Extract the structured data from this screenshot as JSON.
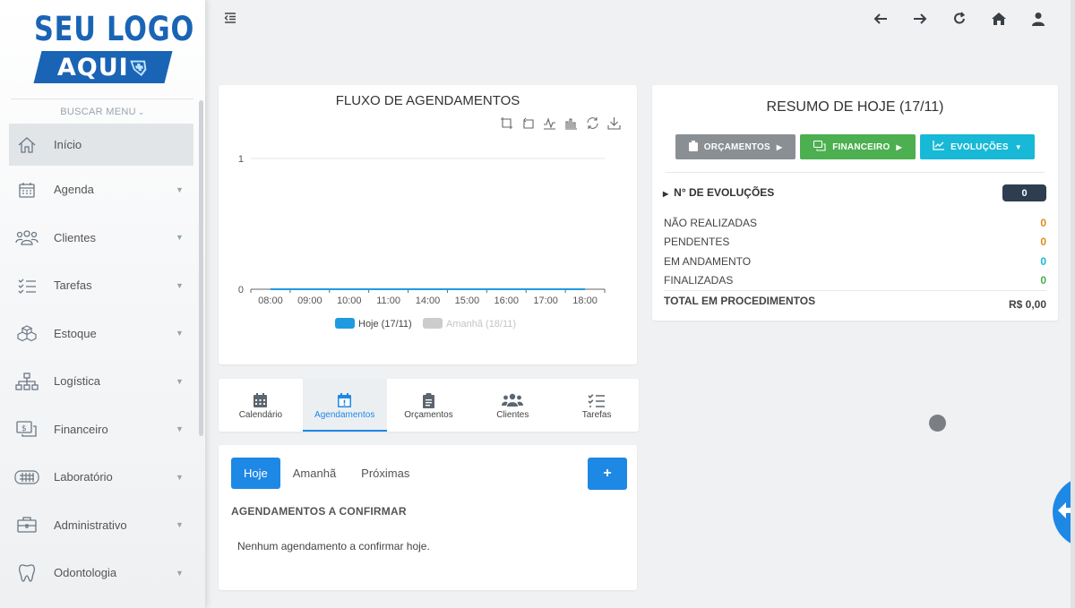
{
  "logo": {
    "line1": "SEU LOGO",
    "line2": "AQUI"
  },
  "sidebar": {
    "search_label": "BUSCAR MENU",
    "items": [
      {
        "label": "Início",
        "icon": "home-icon"
      },
      {
        "label": "Agenda",
        "icon": "calendar-icon"
      },
      {
        "label": "Clientes",
        "icon": "users-icon"
      },
      {
        "label": "Tarefas",
        "icon": "tasks-icon"
      },
      {
        "label": "Estoque",
        "icon": "boxes-icon"
      },
      {
        "label": "Logística",
        "icon": "sitemap-icon"
      },
      {
        "label": "Financeiro",
        "icon": "money-icon"
      },
      {
        "label": "Laboratório",
        "icon": "denture-icon"
      },
      {
        "label": "Administrativo",
        "icon": "briefcase-icon"
      },
      {
        "label": "Odontologia",
        "icon": "tooth-icon"
      }
    ]
  },
  "topbar": {
    "icons": [
      "back-arrow-icon",
      "forward-arrow-icon",
      "reload-icon",
      "home-icon",
      "user-icon"
    ]
  },
  "chart_card": {
    "title": "FLUXO DE AGENDAMENTOS",
    "tools": [
      "zoom-icon",
      "zoom-reset-icon",
      "line-chart-icon",
      "bar-chart-icon",
      "restore-icon",
      "download-icon"
    ]
  },
  "chart_data": {
    "type": "line",
    "x": [
      "08:00",
      "09:00",
      "10:00",
      "11:00",
      "14:00",
      "15:00",
      "16:00",
      "17:00",
      "18:00"
    ],
    "y_ticks": [
      "0",
      "1"
    ],
    "ylim": [
      0,
      1
    ],
    "series": [
      {
        "name": "Hoje (17/11)",
        "values": [
          0,
          0,
          0,
          0,
          0,
          0,
          0,
          0,
          0
        ],
        "color": "#1e9be0",
        "active": true
      },
      {
        "name": "Amanhã (18/11)",
        "values": [
          0,
          0,
          0,
          0,
          0,
          0,
          0,
          0,
          0
        ],
        "color": "#cccccc",
        "active": false
      }
    ],
    "legend_position": "bottom",
    "grid": true
  },
  "tabs": [
    {
      "label": "Calendário",
      "icon": "calendar-icon",
      "active": false
    },
    {
      "label": "Agendamentos",
      "icon": "calendar-exclamation-icon",
      "active": true
    },
    {
      "label": "Orçamentos",
      "icon": "clipboard-icon",
      "active": false
    },
    {
      "label": "Clientes",
      "icon": "users-icon",
      "active": false
    },
    {
      "label": "Tarefas",
      "icon": "tasks-icon",
      "active": false
    }
  ],
  "appointments": {
    "pills": [
      "Hoje",
      "Amanhã",
      "Próximas"
    ],
    "add_label": "+",
    "heading": "AGENDAMENTOS A CONFIRMAR",
    "empty_text": "Nenhum agendamento a confirmar hoje."
  },
  "summary": {
    "title": "RESUMO DE HOJE (17/11)",
    "buttons": [
      {
        "label": "ORÇAMENTOS",
        "icon": "clipboard-icon",
        "color": "#8a8f94"
      },
      {
        "label": "FINANCEIRO",
        "icon": "money-icon",
        "color": "#4caf50"
      },
      {
        "label": "EVOLUÇÕES",
        "icon": "chart-icon",
        "color": "#17b9d6"
      }
    ],
    "evolutions_label": "N° DE EVOLUÇÕES",
    "evolutions_count": "0",
    "rows": [
      {
        "label": "NÃO REALIZADAS",
        "value": "0",
        "color": "#e08a1e"
      },
      {
        "label": "PENDENTES",
        "value": "0",
        "color": "#e08a1e"
      },
      {
        "label": "EM ANDAMENTO",
        "value": "0",
        "color": "#17b9d6"
      },
      {
        "label": "FINALIZADAS",
        "value": "0",
        "color": "#4caf50"
      }
    ],
    "total_label": "TOTAL EM PROCEDIMENTOS",
    "total_value": "R$ 0,00"
  }
}
